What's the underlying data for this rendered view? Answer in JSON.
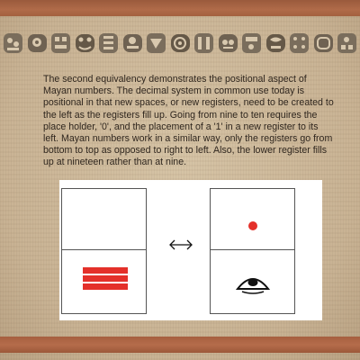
{
  "content": {
    "paragraph": "The second equivalency demonstrates the positional aspect of Mayan numbers. The decimal system in common use today is positional in that new spaces, or new registers, need to be created to the left as the registers fill up. Going from nine to ten requires the place holder, '0', and the placement of a '1' in a new register to its left. Mayan numbers work in a similar way, only the registers go from bottom to top as opposed to right to left.  Also, the lower register fills up at nineteen rather than at nine."
  },
  "diagram": {
    "left_register": {
      "lower_value": 15,
      "upper_value": null,
      "lower_symbol": "three bars"
    },
    "right_register": {
      "upper_value": 1,
      "lower_value": 0,
      "upper_symbol": "dot",
      "lower_symbol": "shell"
    },
    "arrow_symbol": "double-headed-arrow"
  },
  "colors": {
    "background": "#cdb89a",
    "stripe": "#a3613f",
    "text": "#2f261e",
    "numeral_red": "#e4302a"
  },
  "icons": [
    "mayan-glyph-icon",
    "double-headed-arrow-icon",
    "dot-icon",
    "shell-icon"
  ]
}
